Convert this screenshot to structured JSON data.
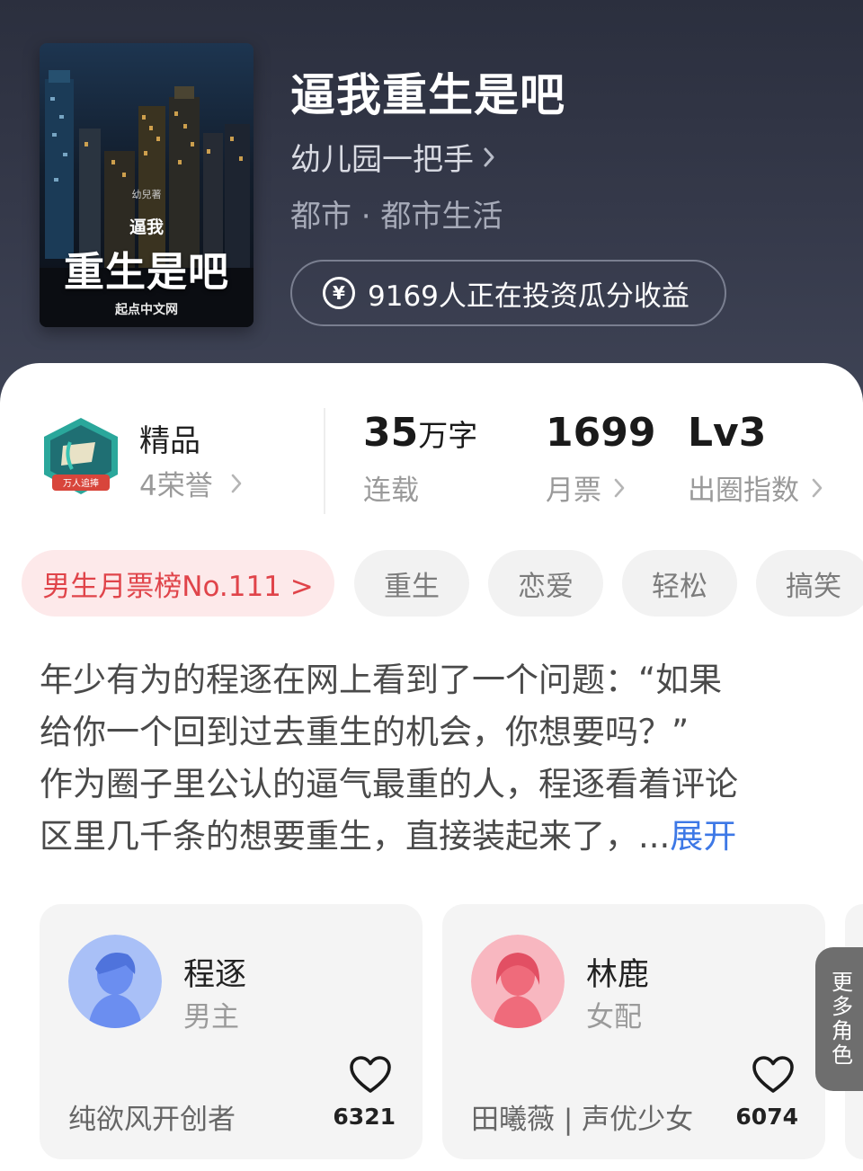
{
  "book": {
    "title": "逼我重生是吧",
    "author": "幼儿园一把手",
    "genre": "都市 · 都市生活",
    "investment_text": "9169人正在投资瓜分收益",
    "investment_icon": "yen-icon"
  },
  "cover": {
    "author_small": "幼兒著",
    "title_small": "逼我",
    "title_big": "重生是吧",
    "publisher": "起点中文网"
  },
  "quality": {
    "tier": "精品",
    "honors": "4荣誉",
    "badge_caption": "万人追捧"
  },
  "stats": {
    "words_value": "35",
    "words_unit": "万字",
    "words_label": "连载",
    "votes_value": "1699",
    "votes_label": "月票",
    "level_value": "Lv3",
    "level_label": "出圈指数"
  },
  "tags": [
    {
      "label": "男生月票榜No.111 >"
    },
    {
      "label": "重生"
    },
    {
      "label": "恋爱"
    },
    {
      "label": "轻松"
    },
    {
      "label": "搞笑"
    }
  ],
  "synopsis": {
    "lines": [
      "年少有为的程逐在网上看到了一个问题：“如果",
      "给你一个回到过去重生的机会，你想要吗？”",
      "作为圈子里公认的逼气最重的人，程逐看着评论",
      "区里几千条的想要重生，直接装起来了，..."
    ],
    "expand_label": "展开"
  },
  "characters": [
    {
      "name": "程逐",
      "role": "男主",
      "description": "纯欲风开创者",
      "likes": "6321",
      "avatar_color": "#6b8ef0"
    },
    {
      "name": "林鹿",
      "role": "女配",
      "description": "田曦薇 | 声优少女",
      "likes": "6074",
      "avatar_color": "#ef6b7b"
    }
  ],
  "more_roles_label": [
    "更",
    "多",
    "角",
    "色"
  ],
  "colors": {
    "header_bg": "#2f3343",
    "rank_tag_text": "#e0444a",
    "rank_tag_bg": "#fde9ea",
    "expand_link": "#3d78e6",
    "badge_teal": "#2aa79b",
    "badge_red": "#d8453b"
  }
}
